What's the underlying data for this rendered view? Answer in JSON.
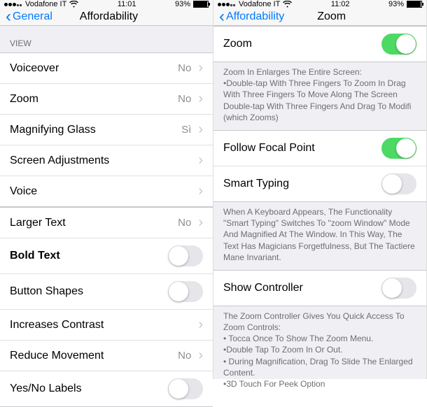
{
  "left": {
    "status": {
      "carrier": "Vodafone IT",
      "time": "11:01",
      "battery_pct": "93%",
      "battery_fill": 0.93
    },
    "nav": {
      "back": "General",
      "title": "Affordability"
    },
    "view_header": "VIEW",
    "rows1": [
      {
        "label": "Voiceover",
        "value": "No"
      },
      {
        "label": "Zoom",
        "value": "No"
      },
      {
        "label": "Magnifying Glass",
        "value": "Sì"
      },
      {
        "label": "Screen Adjustments",
        "value": ""
      },
      {
        "label": "Voice",
        "value": ""
      }
    ],
    "rows2": {
      "larger_text": {
        "label": "Larger Text",
        "value": "No"
      },
      "bold_text": {
        "label": "Bold Text",
        "on": false
      },
      "button_shapes": {
        "label": "Button Shapes",
        "on": false
      },
      "increases_contrast": {
        "label": "Increases Contrast",
        "value": ""
      },
      "reduce_movement": {
        "label": "Reduce Movement",
        "value": "No"
      },
      "yes_no_labels": {
        "label": "Yes/No Labels",
        "on": false
      }
    }
  },
  "right": {
    "status": {
      "carrier": "Vodafone IT",
      "time": "11:02",
      "battery_pct": "93%",
      "battery_fill": 0.93
    },
    "nav": {
      "back": "Affordability",
      "title": "Zoom"
    },
    "zoom_row": {
      "label": "Zoom",
      "on": true
    },
    "zoom_desc_title": "Zoom In Enlarges The Entire Screen:",
    "zoom_desc_1": "•Double-tap With Three Fingers To Zoom In Drag With Three Fingers To Move Along The Screen",
    "zoom_desc_2": "Double-tap With Three Fingers And Drag To Modifi (which Zooms)",
    "follow_focal": {
      "label": "Follow Focal Point",
      "on": true
    },
    "smart_typing": {
      "label": "Smart Typing",
      "on": false
    },
    "smart_desc": "When A Keyboard Appears, The Functionality \"Smart Typing\" Switches To \"zoom Window\" Mode And Magnified At The Window. In This Way, The Text Has Magicians Forgetfulness, But The Tactiere Mane Invariant.",
    "show_controller": {
      "label": "Show Controller",
      "on": false
    },
    "controller_desc_title": "The Zoom Controller Gives You Quick Access To Zoom Controls:",
    "controller_desc_1": "• Tocca Once To Show The Zoom Menu.",
    "controller_desc_2": "•Double Tap To Zoom In Or Out.",
    "controller_desc_3": "• During Magnification, Drag To Slide The Enlarged Content.",
    "controller_desc_4": "•3D Touch For Peek Option"
  }
}
